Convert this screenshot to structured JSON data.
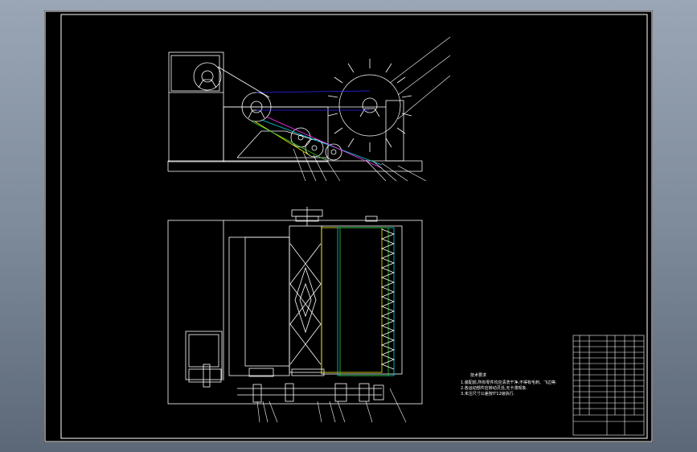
{
  "viewport": {
    "background": "#8a96a6"
  },
  "drawing": {
    "background": "#000000",
    "line_color": "#ffffff",
    "accent_colors": {
      "blue": "#2828ff",
      "cyan": "#00d8d8",
      "magenta": "#ff33ff",
      "yellow": "#f0f000",
      "green": "#33cc33"
    },
    "notes": {
      "title": "技术要求",
      "lines": [
        "1.装配前,所有零件均应清洗干净,不得有毛刺、飞边等.",
        "2.各运动部件应转动灵活,无卡滞现象.",
        "3.未注尺寸公差按IT12级执行."
      ]
    }
  }
}
